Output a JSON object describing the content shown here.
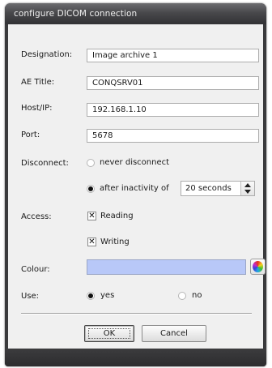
{
  "window": {
    "title": "configure DICOM connection"
  },
  "form": {
    "designation": {
      "label": "Designation:",
      "value": "Image archive 1"
    },
    "ae_title": {
      "label": "AE Title:",
      "value": "CONQSRV01"
    },
    "host": {
      "label": "Host/IP:",
      "value": "192.168.1.10"
    },
    "port": {
      "label": "Port:",
      "value": "5678"
    },
    "disconnect": {
      "label": "Disconnect:",
      "option_never": "never disconnect",
      "option_after": "after inactivity of",
      "selected": "after inactivity of",
      "inactivity_value": "20 seconds"
    },
    "access": {
      "label": "Access:",
      "reading_label": "Reading",
      "reading_checked": true,
      "writing_label": "Writing",
      "writing_checked": true
    },
    "colour": {
      "label": "Colour:",
      "value": "#b8c8f8"
    },
    "use": {
      "label": "Use:",
      "option_yes": "yes",
      "option_no": "no",
      "selected": "yes"
    }
  },
  "buttons": {
    "ok": "OK",
    "cancel": "Cancel"
  },
  "icons": {
    "colour_picker": "color-wheel-icon",
    "spinner_up": "arrow-up-icon",
    "spinner_down": "arrow-down-icon"
  }
}
